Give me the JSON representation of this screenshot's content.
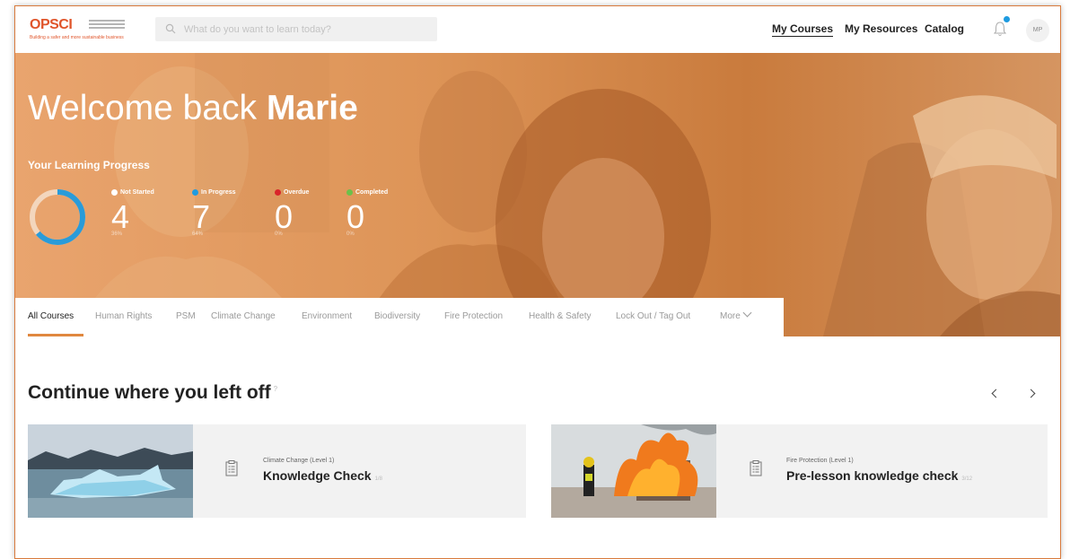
{
  "brand": {
    "logo_text": "OPSCI",
    "tagline": "Building a safer and more sustainable business"
  },
  "search": {
    "placeholder": "What do you want to learn today?"
  },
  "nav": {
    "my_courses": "My Courses",
    "my_resources": "My Resources",
    "catalog": "Catalog"
  },
  "user": {
    "initials": "MP",
    "has_notifications": true
  },
  "hero": {
    "welcome_prefix": "Welcome back ",
    "user_name": "Marie",
    "progress_title": "Your Learning Progress",
    "progress_fraction": 0.36,
    "stats": [
      {
        "label": "Not Started",
        "value": "4",
        "percent": "36%",
        "color": "#ffffff"
      },
      {
        "label": "In Progress",
        "value": "7",
        "percent": "64%",
        "color": "#1e9be0"
      },
      {
        "label": "Overdue",
        "value": "0",
        "percent": "0%",
        "color": "#d9242a"
      },
      {
        "label": "Completed",
        "value": "0",
        "percent": "0%",
        "color": "#6cc04a"
      }
    ]
  },
  "tabs": [
    "All Courses",
    "Human Rights",
    "PSM",
    "Climate Change",
    "Environment",
    "Biodiversity",
    "Fire Protection",
    "Health & Safety",
    "Lock Out / Tag Out",
    "More"
  ],
  "continue": {
    "title": "Continue where you left off",
    "help": "?",
    "cards": [
      {
        "category": "Climate Change (Level 1)",
        "title": "Knowledge Check",
        "count": "1/8"
      },
      {
        "category": "Fire Protection (Level 1)",
        "title": "Pre-lesson knowledge check",
        "count": "3/12"
      }
    ]
  },
  "colors": {
    "brand": "#e0552b",
    "accent": "#e0883f",
    "hero": "#dd9457"
  }
}
